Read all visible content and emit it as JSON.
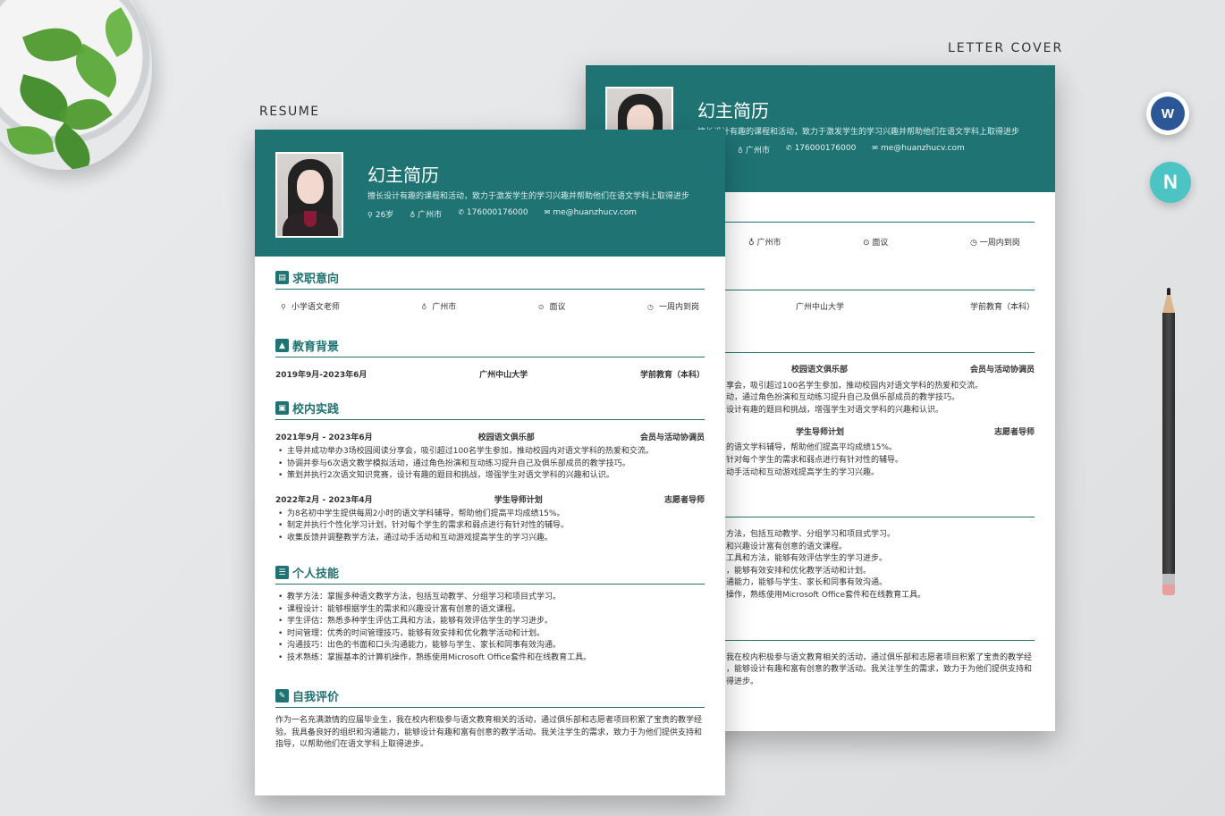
{
  "labels": {
    "resume": "RESUME",
    "cover": "LETTER COVER"
  },
  "icons": {
    "word": "W",
    "app_n": "N"
  },
  "front": {
    "name": "幻主简历",
    "intro": "擅长设计有趣的课程和活动，致力于激发学生的学习兴趣并帮助他们在语文学科上取得进步",
    "contacts": {
      "age": "26岁",
      "city": "广州市",
      "phone": "176000176000",
      "email": "me@huanzhucv.com"
    },
    "intent": {
      "title": "求职意向",
      "position": "小学语文老师",
      "city": "广州市",
      "salary": "面议",
      "arrival": "一周内到岗"
    },
    "education": {
      "title": "教育背景",
      "date": "2019年9月-2023年6月",
      "school": "广州中山大学",
      "degree": "学前教育（本科）"
    },
    "practice": {
      "title": "校内实践",
      "items": [
        {
          "date": "2021年9月 - 2023年6月",
          "org": "校园语文俱乐部",
          "role": "会员与活动协调员",
          "bullets": [
            "主导并成功举办3场校园阅读分享会，吸引超过100名学生参加，推动校园内对语文学科的热爱和交流。",
            "协调并参与6次语文教学模拟活动，通过角色扮演和互动练习提升自己及俱乐部成员的教学技巧。",
            "策划并执行2次语文知识竞赛，设计有趣的题目和挑战，增强学生对语文学科的兴趣和认识。"
          ]
        },
        {
          "date": "2022年2月 - 2023年4月",
          "org": "学生导师计划",
          "role": "志愿者导师",
          "bullets": [
            "为8名初中学生提供每周2小时的语文学科辅导，帮助他们提高平均成绩15%。",
            "制定并执行个性化学习计划，针对每个学生的需求和弱点进行有针对性的辅导。",
            "收集反馈并调整教学方法，通过动手活动和互动游戏提高学生的学习兴趣。"
          ]
        }
      ]
    },
    "skills": {
      "title": "个人技能",
      "items": [
        "教学方法：掌握多种语文教学方法，包括互动教学、分组学习和项目式学习。",
        "课程设计：能够根据学生的需求和兴趣设计富有创意的语文课程。",
        "学生评估：熟悉多种学生评估工具和方法，能够有效评估学生的学习进步。",
        "时间管理：优秀的时间管理技巧，能够有效安排和优化教学活动和计划。",
        "沟通技巧：出色的书面和口头沟通能力，能够与学生、家长和同事有效沟通。",
        "技术熟练：掌握基本的计算机操作，熟练使用Microsoft Office套件和在线教育工具。"
      ]
    },
    "self": {
      "title": "自我评价",
      "text": "作为一名充满激情的应届毕业生，我在校内积极参与语文教育相关的活动，通过俱乐部和志愿者项目积累了宝贵的教学经验。我具备良好的组织和沟通能力，能够设计有趣和富有创意的教学活动。我关注学生的需求，致力于为他们提供支持和指导，以帮助他们在语文学科上取得进步。"
    }
  },
  "back": {
    "name": "幻主简历",
    "intro": "擅长设计有趣的课程和活动，致力于激发学生的学习兴趣并帮助他们在语文学科上取得进步",
    "contacts": {
      "city": "广州市",
      "phone": "176000176000",
      "email": "me@huanzhucv.com"
    },
    "intent": {
      "city": "广州市",
      "salary": "面议",
      "arrival": "一周内到岗"
    },
    "education": {
      "school": "广州中山大学",
      "degree": "学前教育（本科）"
    },
    "practice1": {
      "org": "校园语文俱乐部",
      "role": "会员与活动协调员",
      "lines": [
        "享会，吸引超过100名学生参加，推动校园内对语文学科的热爱和交流。",
        "动，通过角色扮演和互动练习提升自己及俱乐部成员的教学技巧。",
        "设计有趣的题目和挑战，增强学生对语文学科的兴趣和认识。"
      ]
    },
    "practice2": {
      "org": "学生导师计划",
      "role": "志愿者导师",
      "lines": [
        "的语文学科辅导，帮助他们提高平均成绩15%。",
        "针对每个学生的需求和弱点进行有针对性的辅导。",
        "动手活动和互动游戏提高学生的学习兴趣。"
      ]
    },
    "skills": {
      "lines": [
        "方法，包括互动教学、分组学习和项目式学习。",
        "和兴趣设计富有创意的语文课程。",
        "工具和方法，能够有效评估学生的学习进步。",
        "，能够有效安排和优化教学活动和计划。",
        "通能力，能够与学生、家长和同事有效沟通。",
        "操作，熟练使用Microsoft Office套件和在线教育工具。"
      ]
    },
    "self": {
      "lines": [
        "我在校内积极参与语文教育相关的活动，通过俱乐部和志愿者项目积累了宝贵的教学经",
        "，能够设计有趣和富有创意的教学活动。我关注学生的需求，致力于为他们提供支持和",
        "得进步。"
      ]
    }
  }
}
